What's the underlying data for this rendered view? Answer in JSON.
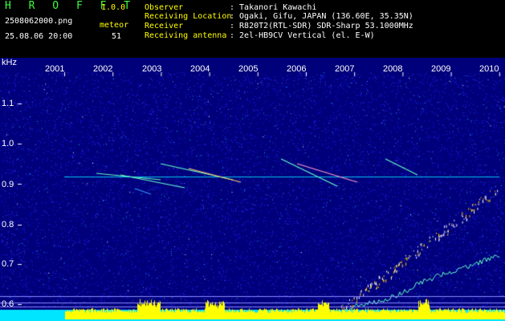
{
  "header": {
    "app_title": "H R O F F T",
    "app_version": "1.0.0",
    "filename": "2508062000.png",
    "datetime": "25.08.06 20:00",
    "meteor_label": "meteor",
    "meteor_count": "51"
  },
  "info": [
    {
      "key": "Observer",
      "value": ": Takanori Kawachi"
    },
    {
      "key": "Receiving Location",
      "value": ": Ogaki, Gifu, JAPAN (136.60E, 35.35N)"
    },
    {
      "key": "Receiver",
      "value": ": R820T2(RTL-SDR) SDR-Sharp 53.1000MHz"
    },
    {
      "key": "Receiving antenna",
      "value": ": 2el-HB9CV Vertical (el. E-W)"
    }
  ],
  "spectrogram": {
    "y_unit": "kHz",
    "x_ticks": [
      "2001",
      "2002",
      "2003",
      "2004",
      "2005",
      "2006",
      "2007",
      "2008",
      "2009",
      "2010"
    ],
    "y_ticks": [
      "1.1",
      "1.0",
      "0.9",
      "0.8",
      "0.7",
      "0.6"
    ],
    "colors": {
      "background": "#00007a",
      "noise_level": "#ffff00",
      "signal_line": "#00e5ff"
    }
  }
}
